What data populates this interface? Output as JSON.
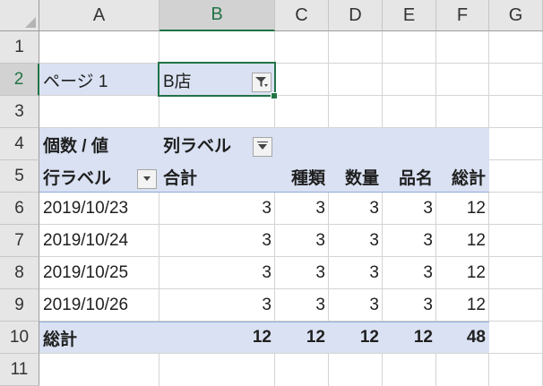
{
  "columns": [
    "A",
    "B",
    "C",
    "D",
    "E",
    "F",
    "G"
  ],
  "rows": [
    "1",
    "2",
    "3",
    "4",
    "5",
    "6",
    "7",
    "8",
    "9",
    "10",
    "11"
  ],
  "page_filter": {
    "label": "ページ 1",
    "value": "B店"
  },
  "pivot": {
    "value_label": "個数 / 値",
    "column_labels": "列ラベル",
    "row_labels": "行ラベル",
    "column_headers": [
      "合計",
      "種類",
      "数量",
      "品名",
      "総計"
    ],
    "rows": [
      {
        "label": "2019/10/23",
        "values": [
          "3",
          "3",
          "3",
          "3",
          "12"
        ]
      },
      {
        "label": "2019/10/24",
        "values": [
          "3",
          "3",
          "3",
          "3",
          "12"
        ]
      },
      {
        "label": "2019/10/25",
        "values": [
          "3",
          "3",
          "3",
          "3",
          "12"
        ]
      },
      {
        "label": "2019/10/26",
        "values": [
          "3",
          "3",
          "3",
          "3",
          "12"
        ]
      }
    ],
    "grand_total": {
      "label": "総計",
      "values": [
        "12",
        "12",
        "12",
        "12",
        "48"
      ]
    }
  },
  "colors": {
    "header_band": "#d9e1f2",
    "selection": "#217346"
  },
  "icons": {
    "filter": "filter-icon",
    "dropdown": "dropdown-arrow-icon"
  }
}
